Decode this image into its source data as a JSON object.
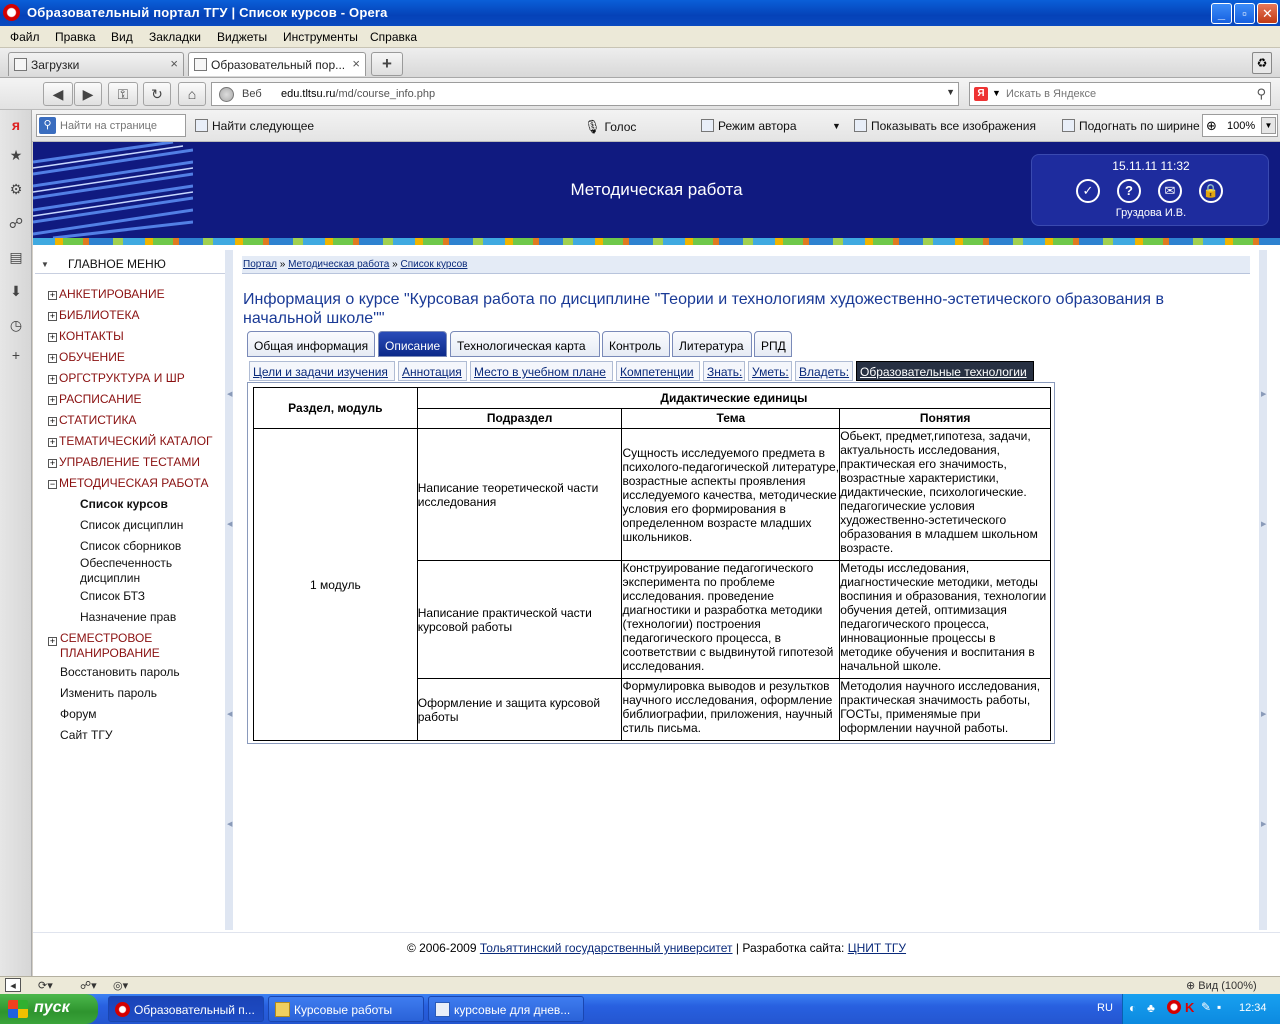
{
  "window": {
    "title": "Образовательный портал ТГУ | Список курсов - Opera"
  },
  "menubar": [
    "Файл",
    "Правка",
    "Вид",
    "Закладки",
    "Виджеты",
    "Инструменты",
    "Справка"
  ],
  "browser_tabs": [
    {
      "label": "Загрузки"
    },
    {
      "label": "Образовательный пор..."
    }
  ],
  "address": {
    "web_label": "Веб",
    "url_host": "edu.tltsu.ru",
    "url_path": "/md/course_info.php",
    "search_placeholder": "Искать в Яндексе"
  },
  "findbar": {
    "placeholder": "Найти на странице",
    "find_next": "Найти следующее",
    "voice": "Голос",
    "author_mode": "Режим автора",
    "show_images": "Показывать все изображения",
    "fit_width": "Подогнать по ширине",
    "zoom": "100%"
  },
  "banner": {
    "title": "Методическая работа",
    "datetime": "15.11.11 11:32",
    "user": "Груздова И.В."
  },
  "sidebar": {
    "header": "ГЛАВНОЕ МЕНЮ",
    "items": [
      {
        "label": "АНКЕТИРОВАНИЕ",
        "sign": "+"
      },
      {
        "label": "БИБЛИОТЕКА",
        "sign": "+"
      },
      {
        "label": "КОНТАКТЫ",
        "sign": "+"
      },
      {
        "label": "ОБУЧЕНИЕ",
        "sign": "+"
      },
      {
        "label": "ОРГСТРУКТУРА И ШР",
        "sign": "+"
      },
      {
        "label": "РАСПИСАНИЕ",
        "sign": "+"
      },
      {
        "label": "СТАТИСТИКА",
        "sign": "+"
      },
      {
        "label": "ТЕМАТИЧЕСКИЙ КАТАЛОГ",
        "sign": "+"
      },
      {
        "label": "УПРАВЛЕНИЕ ТЕСТАМИ",
        "sign": "+"
      },
      {
        "label": "МЕТОДИЧЕСКАЯ РАБОТА",
        "sign": "−"
      }
    ],
    "subitems": [
      "Список курсов",
      "Список дисциплин",
      "Список сборников",
      "Обеспеченность дисциплин",
      "Список БТЗ",
      "Назначение прав"
    ],
    "semester": "СЕМЕСТРОВОЕ ПЛАНИРОВАНИЕ",
    "links": [
      "Восстановить пароль",
      "Изменить пароль",
      "Форум",
      "Сайт ТГУ"
    ]
  },
  "breadcrumb": [
    "Портал",
    "Методическая работа",
    "Список курсов"
  ],
  "breadcrumb_sep": "»",
  "course_title": "Информация о курсе \"Курсовая работа по дисциплине \"Теории и технологиям художественно-эстетического образования в начальной школе\"\"",
  "tabs": [
    "Общая информация",
    "Описание",
    "Технологическая карта",
    "Контроль",
    "Литература",
    "РПД"
  ],
  "subtabs": [
    "Цели и задачи изучения",
    "Аннотация",
    "Место в учебном плане",
    "Компетенции",
    "Знать:",
    "Уметь:",
    "Владеть:",
    "Образовательные технологии"
  ],
  "table": {
    "col_section": "Раздел, модуль",
    "col_group": "Дидактические единицы",
    "col_sub": "Подраздел",
    "col_theme": "Тема",
    "col_concepts": "Понятия",
    "module": "1 модуль",
    "rows": [
      {
        "sub": "Написание теоретической части исследования",
        "theme": "Сущность исследуемого предмета в психолого-педагогической литературе, возрастные аспекты проявления исследуемого качества, методические условия его формирования в определенном возрасте младших школьников.",
        "concepts": "Обьект, предмет,гипотеза, задачи, актуальность исследования, практическая его значимость, возрастные характеристики, дидактические, психологические. педагогические условия художественно-эстетического образования в младшем школьном возрасте."
      },
      {
        "sub": "Написание практической части курсовой работы",
        "theme": "Конструирование педагогического эксперимента по проблеме исследования. проведение диагностики и разработка методики (технологии) построения педагогического процесса, в соответствии с выдвинутой гипотезой исследования.",
        "concepts": "Методы исследования, диагностические методики, методы воспиния и образования, технологии обучения детей, оптимизация педагогического процесса, инновационные процессы в методике обучения и воспитания в начальной школе."
      },
      {
        "sub": "Оформление и защита курсовой работы",
        "theme": "Формулировка выводов и результков научного исследования, оформление библиографии, приложения, научный стиль письма.",
        "concepts": "Методолия научного исследования, практическая значимость работы, ГОСТы, применямые при оформлении научной работы."
      }
    ]
  },
  "footer": {
    "prefix": "© 2006-2009",
    "university": "Тольяттинский государственный университет",
    "sep": "| Разработка сайта:",
    "dev": "ЦНИТ ТГУ"
  },
  "statusbar": {
    "view": "Вид (100%)"
  },
  "taskbar": {
    "start": "пуск",
    "tasks": [
      "Образовательный п...",
      "Курсовые работы",
      "курсовые для днев..."
    ],
    "lang": "RU",
    "clock": "12:34"
  }
}
